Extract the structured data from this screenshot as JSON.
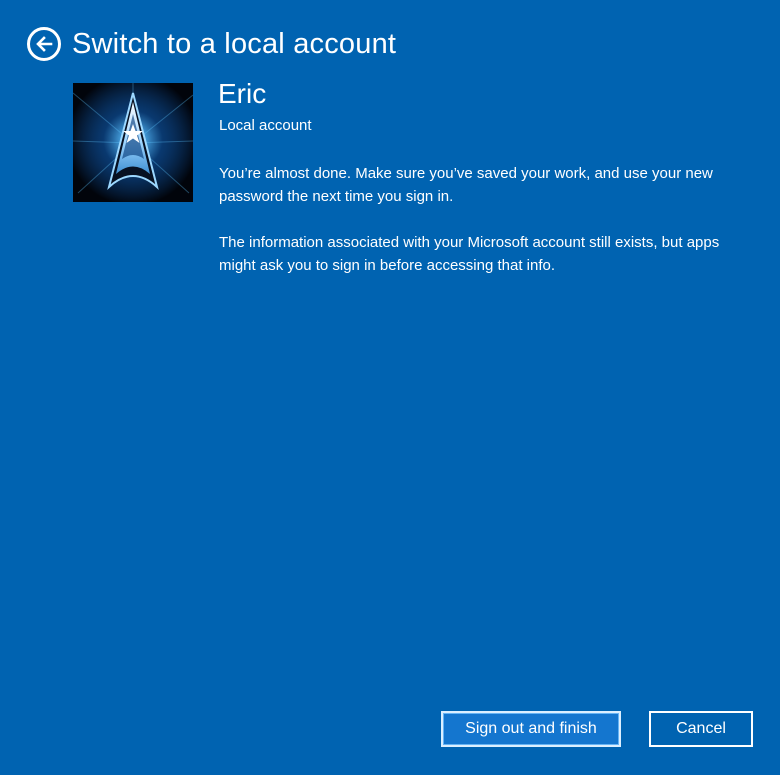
{
  "header": {
    "back_icon": "arrow-left-circle-icon",
    "title": "Switch to a local account"
  },
  "account": {
    "avatar_icon": "starfleet-insignia-avatar",
    "name": "Eric",
    "type": "Local account"
  },
  "messages": [
    "You’re almost done. Make sure you’ve saved your work, and use your new password the next time you sign in.",
    "The information associated with your Microsoft account still exists, but apps might ask you to sign in before accessing that info."
  ],
  "actions": {
    "primary_label": "Sign out and finish",
    "cancel_label": "Cancel"
  },
  "colors": {
    "background": "#0063b1",
    "primary_button": "#1476cf",
    "text": "#ffffff"
  }
}
